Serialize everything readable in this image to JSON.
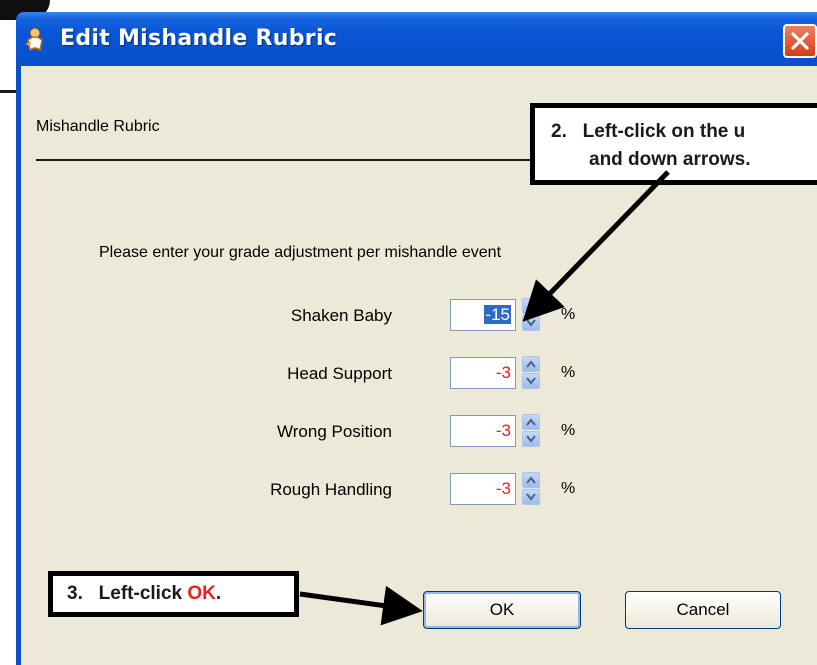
{
  "window": {
    "title": "Edit Mishandle Rubric"
  },
  "group": {
    "title": "Mishandle Rubric"
  },
  "prompt": "Please enter your grade adjustment per mishandle event",
  "rows": [
    {
      "label": "Shaken Baby",
      "value": "-15",
      "unit": "%"
    },
    {
      "label": "Head Support",
      "value": "-3",
      "unit": "%"
    },
    {
      "label": "Wrong Position",
      "value": "-3",
      "unit": "%"
    },
    {
      "label": "Rough Handling",
      "value": "-3",
      "unit": "%"
    }
  ],
  "buttons": {
    "ok": "OK",
    "cancel": "Cancel"
  },
  "annotations": {
    "step2_line1": "2.   Left-click on the u",
    "step2_line2": "and down arrows.",
    "step3_prefix": "3.   Left-click ",
    "step3_ok": "OK",
    "step3_suffix": "."
  },
  "colors": {
    "titlebar": "#0a56d6",
    "value_text": "#e82020",
    "selection": "#316ac5",
    "annotation_red": "#ea1f22"
  }
}
